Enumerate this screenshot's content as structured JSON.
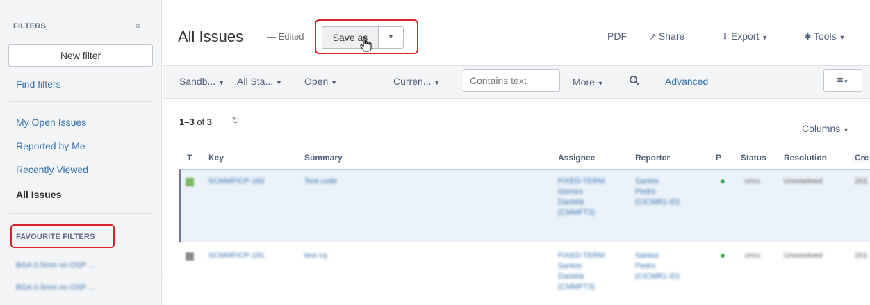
{
  "sidebar": {
    "filters_heading": "FILTERS",
    "collapse_glyph": "«",
    "new_filter": "New filter",
    "find_filters": "Find filters",
    "links": [
      "My Open Issues",
      "Reported by Me",
      "Recently Viewed",
      "All Issues"
    ],
    "active_link": "All Issues",
    "favourite_heading": "FAVOURITE FILTERS",
    "favourites": [
      "BGA 0.5mm on OSP ...",
      "BGA 0.5mm on OSP ..."
    ]
  },
  "header": {
    "title": "All Issues",
    "edited": "— Edited",
    "save_as": "Save as",
    "pdf": "PDF",
    "share": "Share",
    "export": "Export",
    "tools": "Tools"
  },
  "toolbar": {
    "project": "Sandb...",
    "status": "All Sta...",
    "resolution": "Open",
    "assignee": "Curren...",
    "search_placeholder": "Contains text",
    "more": "More",
    "advanced": "Advanced"
  },
  "results": {
    "count_range": "1–3",
    "count_of": "of",
    "count_total": "3",
    "columns_label": "Columns",
    "headers": [
      "T",
      "Key",
      "Summary",
      "Assignee",
      "Reporter",
      "P",
      "Status",
      "Resolution",
      "Cre"
    ],
    "rows": [
      {
        "key": "SCMMFICP-182",
        "summary": "Test code",
        "assignee": [
          "FIXED-TERM",
          "Gomes",
          "Daniela",
          "(CMMFT3)"
        ],
        "reporter": [
          "Santos",
          "Pedro",
          "(CICMR1-ID)"
        ],
        "status": "OPEN",
        "resolution": "Unresolved",
        "created": "201"
      },
      {
        "key": "SCMMFICP-181",
        "summary": "test cq",
        "assignee": [
          "FIXED-TERM",
          "Santos",
          "Daniela",
          "(CMMFT3)"
        ],
        "reporter": [
          "Santos",
          "Pedro",
          "(CICMR1-ID)"
        ],
        "status": "OPEN",
        "resolution": "Unresolved",
        "created": "201"
      }
    ]
  },
  "colors": {
    "link": "#3572b0",
    "highlight": "#d8232a",
    "selected_row": "#ebf2f9",
    "priority": "#2fa84f"
  }
}
